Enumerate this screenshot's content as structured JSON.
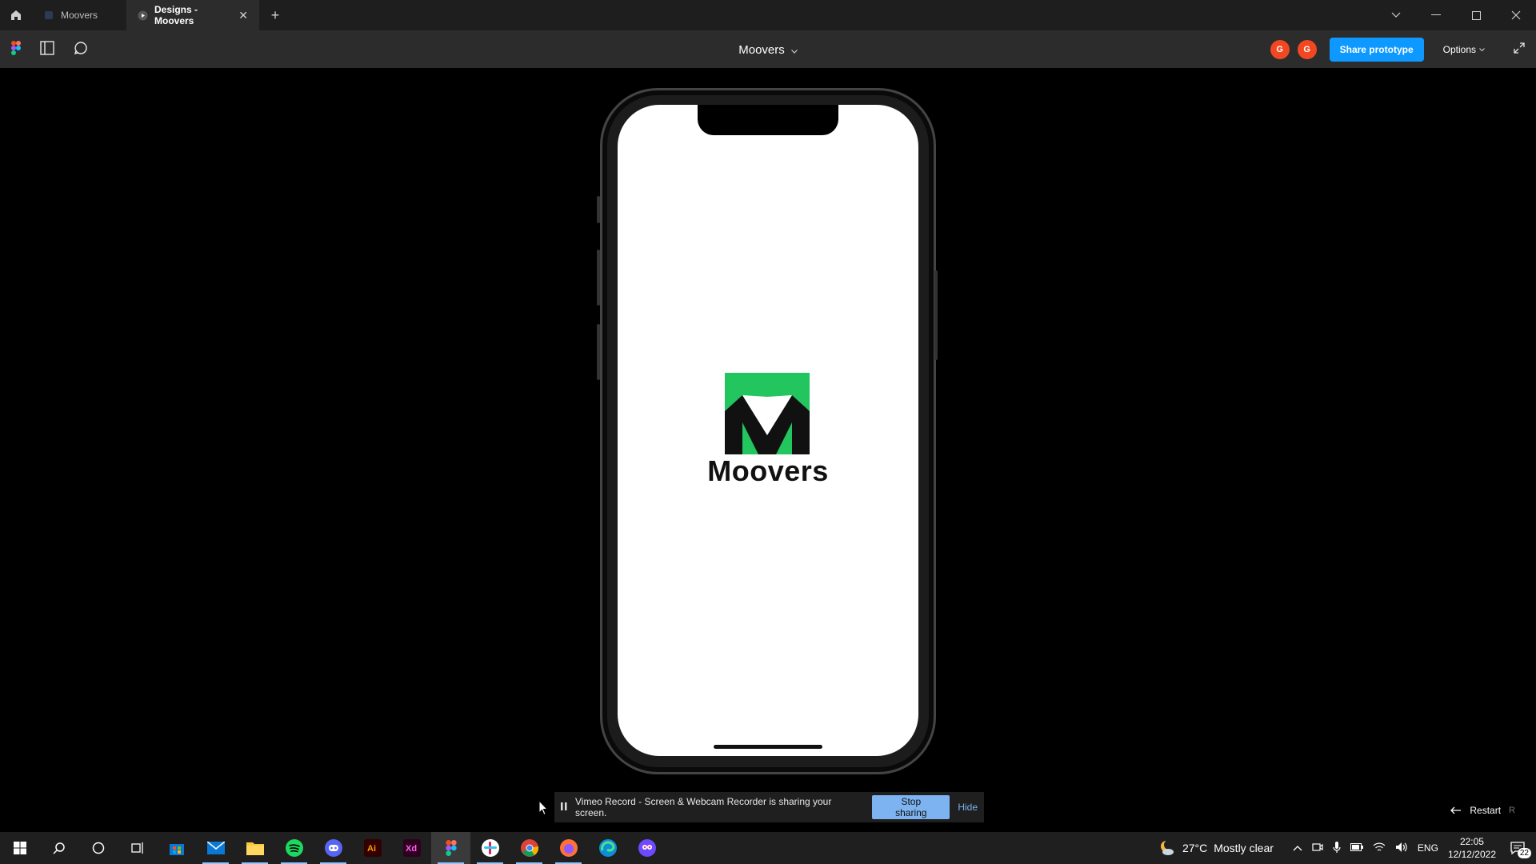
{
  "browser": {
    "tabs": [
      {
        "label": "Moovers",
        "active": false
      },
      {
        "label": "Designs - Moovers",
        "active": true
      }
    ]
  },
  "toolbar": {
    "file_name": "Moovers",
    "avatars": [
      "G",
      "G"
    ],
    "share_label": "Share prototype",
    "options_label": "Options"
  },
  "prototype": {
    "app_name": "Moovers",
    "brand_color": "#22c55e"
  },
  "share_banner": {
    "message": "Vimeo Record - Screen & Webcam Recorder is sharing your screen.",
    "stop_label": "Stop sharing",
    "hide_label": "Hide"
  },
  "restart": {
    "label": "Restart",
    "shortcut": "R"
  },
  "taskbar": {
    "weather_temp": "27°C",
    "weather_desc": "Mostly clear",
    "language": "ENG",
    "time": "22:05",
    "date": "12/12/2022",
    "notifications": "22",
    "apps": [
      "windows-start",
      "search",
      "cortana",
      "task-view",
      "microsoft-store",
      "mail",
      "file-explorer",
      "spotify",
      "discord",
      "illustrator",
      "adobe-xd",
      "figma",
      "slack",
      "chrome",
      "firefox",
      "edge",
      "vpn-app"
    ]
  }
}
